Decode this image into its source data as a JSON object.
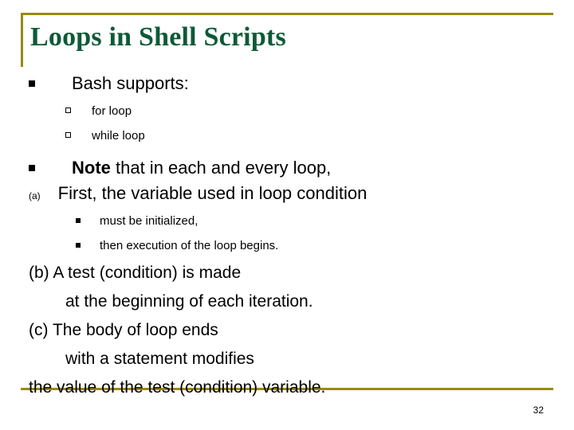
{
  "slide": {
    "title": "Loops in Shell Scripts",
    "page_number": "32",
    "accent_color": "#9a8a0a",
    "title_color": "#0d5a37",
    "bullets": {
      "bash_supports": "Bash supports:",
      "for_loop": "for loop",
      "while_loop": "while loop",
      "note_bold": "Note",
      "note_rest": " that in each and every loop,",
      "a_label": "(a)",
      "a_text": "First, the variable used in loop condition",
      "must_be_initialized": "must be initialized,",
      "then_execution": "then execution of the loop begins."
    },
    "lines": {
      "b_line1": "(b) A test (condition) is made",
      "b_line2": "at the beginning of each iteration.",
      "c_line1": "(c) The body of loop ends",
      "c_line2": "with a statement modifies",
      "c_line3": "the value of the test (condition) variable."
    },
    "icons": {
      "bullet_level1": "filled-square-bullet",
      "bullet_level2": "hollow-square-bullet",
      "bullet_level3": "small-square-bullet"
    }
  }
}
